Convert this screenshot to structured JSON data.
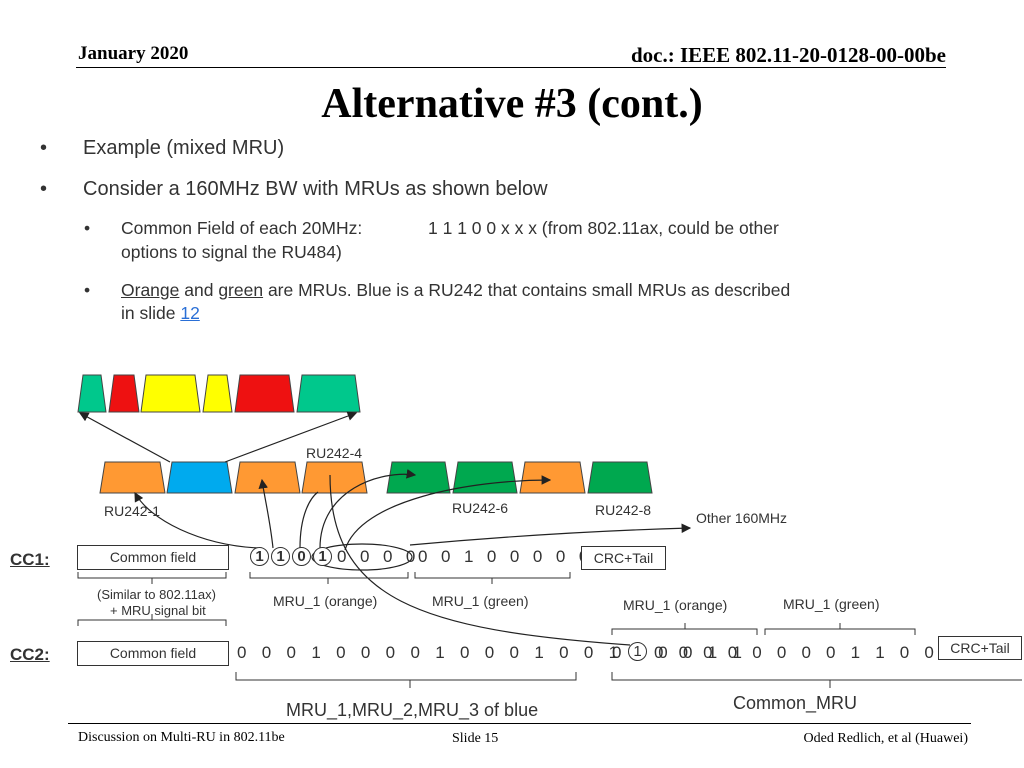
{
  "header": {
    "date": "January 2020",
    "doc": "doc.: IEEE 802.11-20-0128-00-00be"
  },
  "title": "Alternative #3 (cont.)",
  "bullets": [
    {
      "text": "Example (mixed MRU)"
    },
    {
      "text": "Consider a 160MHz BW with MRUs as shown below"
    }
  ],
  "subbullets": {
    "common_field_label": "Common Field of each 20MHz:",
    "common_field_value": "1 1 1 0 0 x x x (from 802.11ax, could be other",
    "common_field_cont": "options to signal the RU484)",
    "orange": "Orange",
    "and": " and ",
    "green": "green",
    "mru_text": " are MRUs. Blue is a RU242 that contains small MRUs as described",
    "in_slide": "in slide ",
    "slide_link": "12"
  },
  "diagram": {
    "top_row_colors": [
      "#00c88c",
      "#ee1111",
      "#ffff00",
      "#ffff00",
      "#ee1111",
      "#00c88c"
    ],
    "ru_row_colors": [
      "#ff9933",
      "#00aaee",
      "#ff9933",
      "#ff9933",
      "#00a84f",
      "#00a84f",
      "#ff9933",
      "#00a84f"
    ],
    "labels": {
      "ru242_4": "RU242-4",
      "ru242_1": "RU242-1",
      "ru242_6": "RU242-6",
      "ru242_8": "RU242-8",
      "other": "Other 160MHz"
    },
    "cc1": {
      "label": "CC1:",
      "common_field": "Common field",
      "circled_bits": [
        "1",
        "1",
        "0",
        "1"
      ],
      "orange_rest": "0 0 0 0",
      "green_bits": "0 0 1 0 0 0 0 0",
      "crc": "CRC+Tail",
      "note1": "(Similar to 802.11ax)",
      "note2": "+ MRU signal bit",
      "mru_orange": "MRU_1 (orange)",
      "mru_green": "MRU_1 (green)"
    },
    "cc2": {
      "label": "CC2:",
      "common_field": "Common field",
      "bits_blue": "0 0 0 1 0 0 0 0 1 0 0 0 1 0 0 1 0 0 0 1 1",
      "bits_mid": "0",
      "circled_bit": "1",
      "bits_rest": "0 0 0 0 0 0 0 0 1 1 0 0 0 0",
      "crc": "CRC+Tail",
      "mru_orange": "MRU_1 (orange)",
      "mru_green": "MRU_1 (green)",
      "blue_label": "MRU_1,MRU_2,MRU_3  of blue",
      "common_mru": "Common_MRU"
    }
  },
  "footer": {
    "left": "Discussion on Multi-RU in 802.11be",
    "center": "Slide 15",
    "right": "Oded Redlich, et al (Huawei)"
  }
}
